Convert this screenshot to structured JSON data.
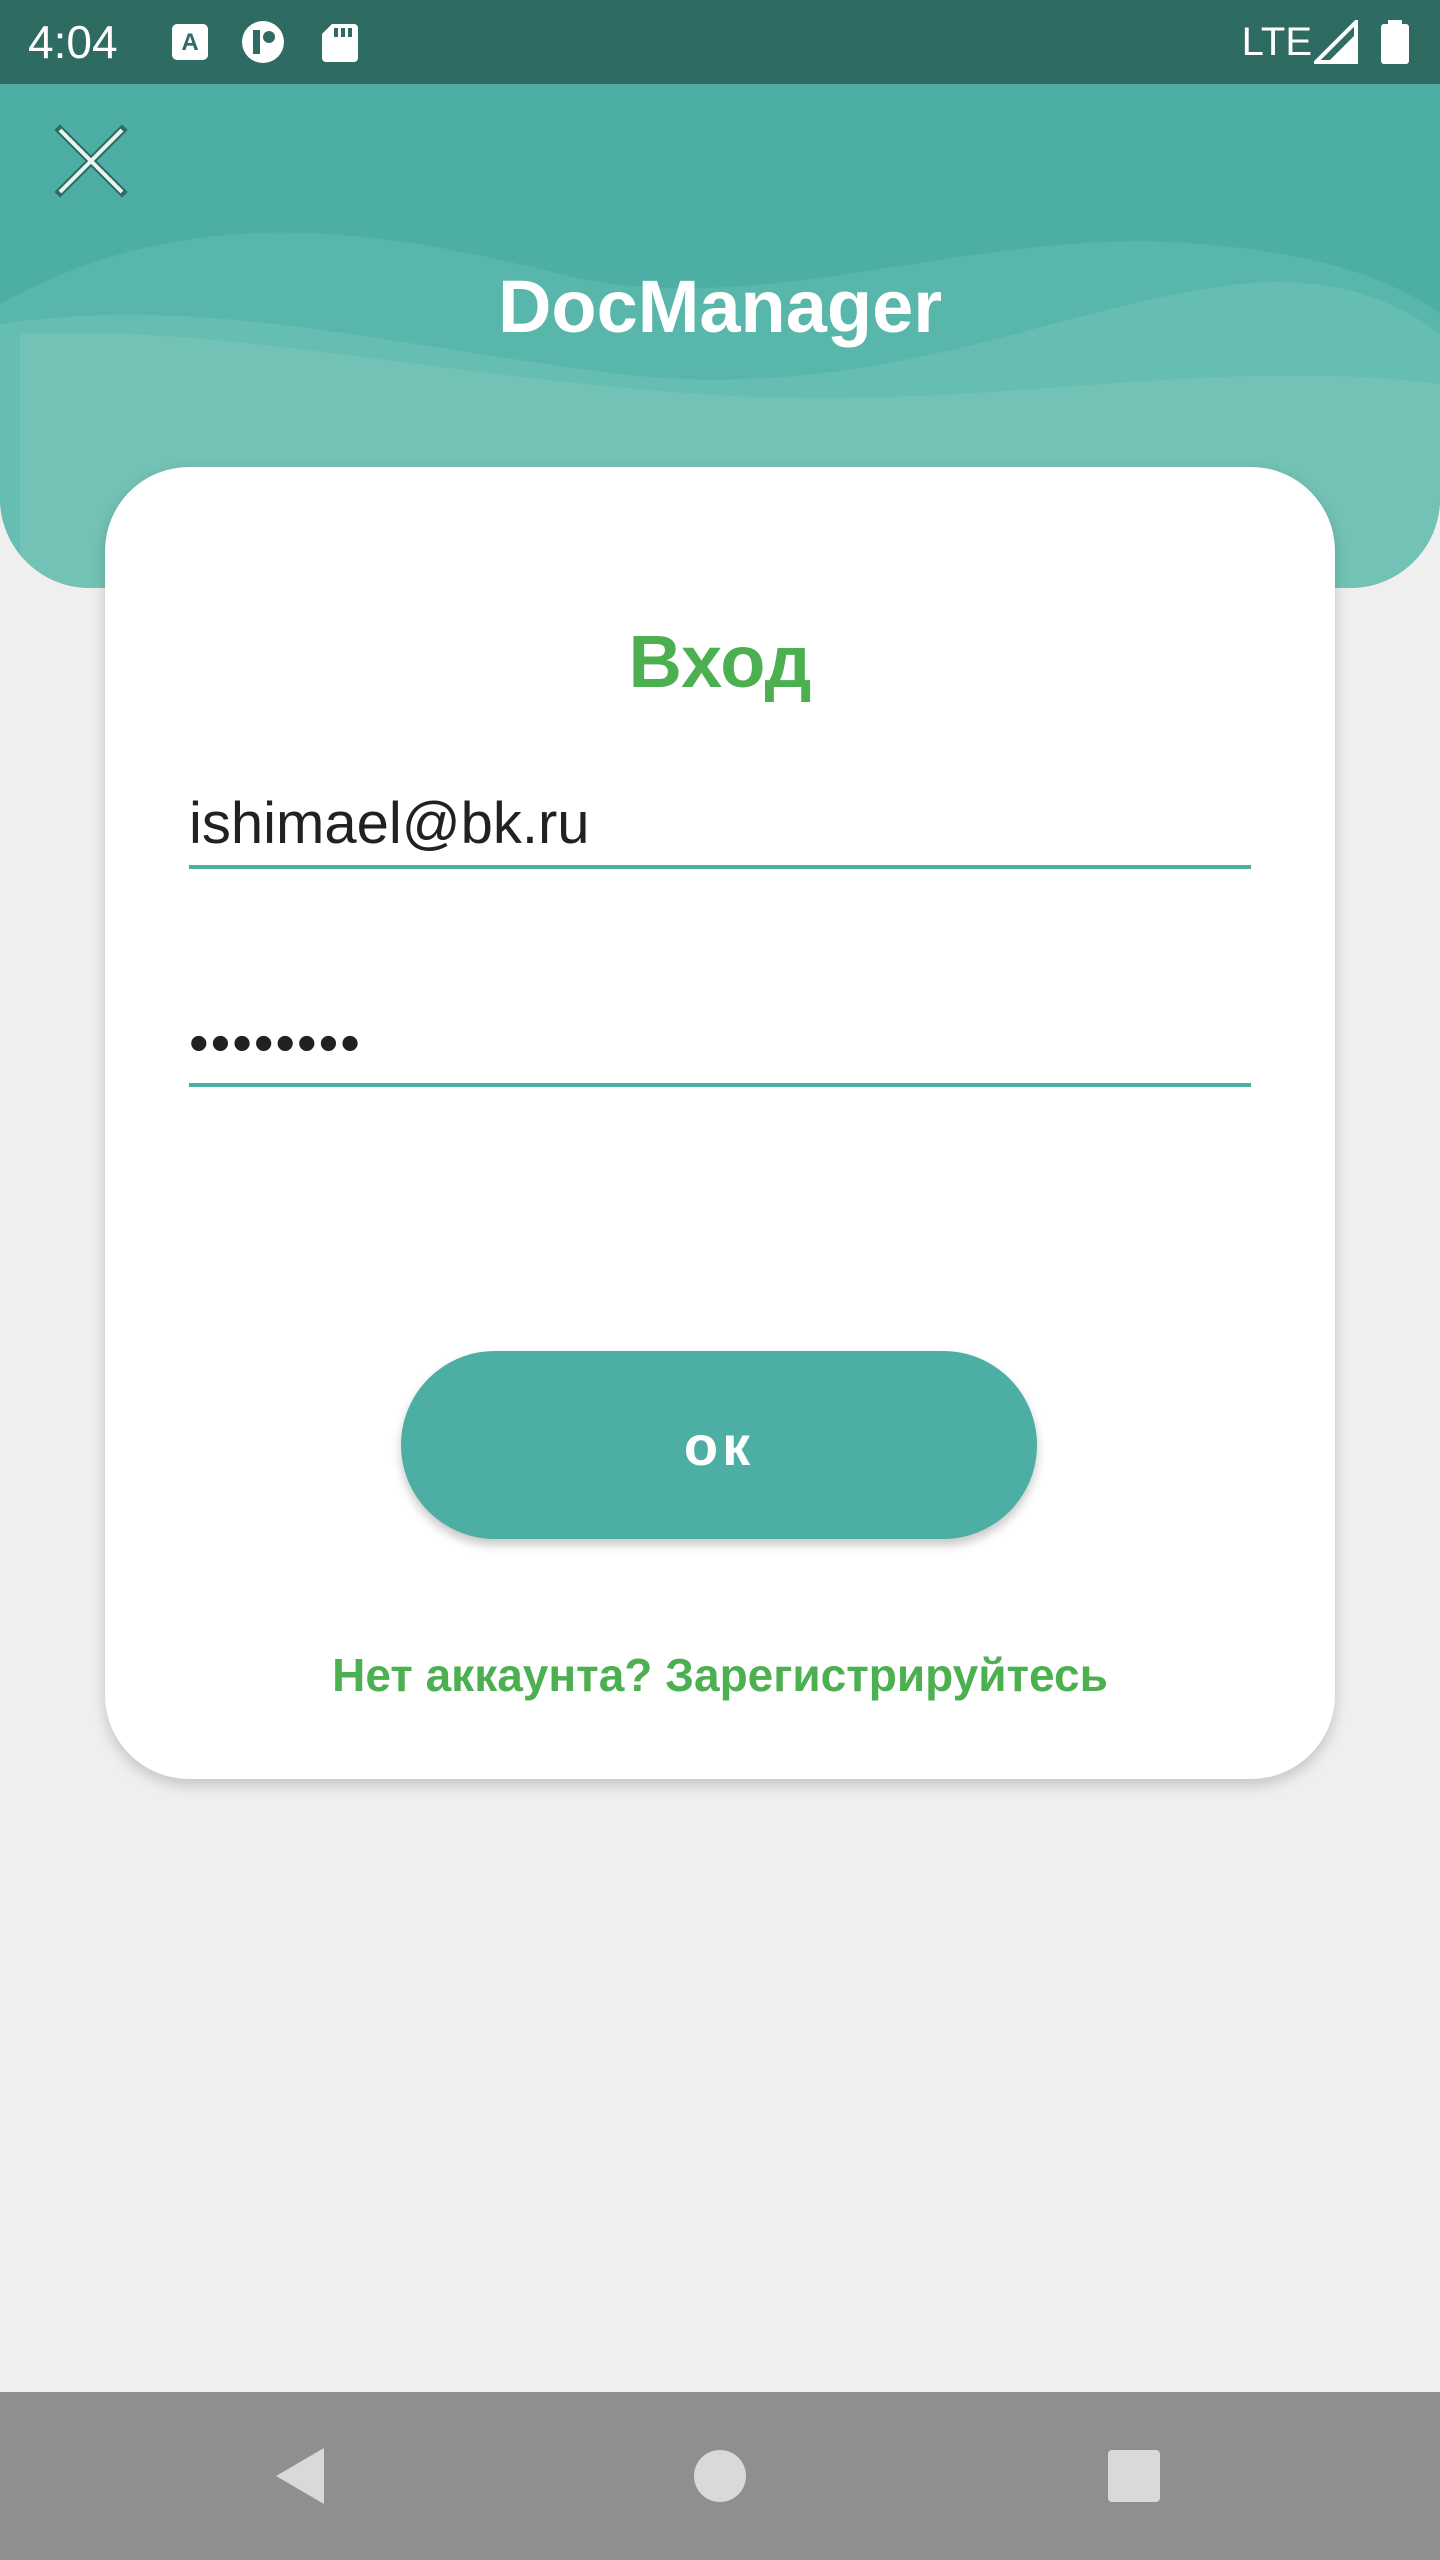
{
  "status_bar": {
    "time": "4:04",
    "network": "LTE",
    "icons": [
      "keyboard-a-icon",
      "cloud-app-icon",
      "sd-card-icon",
      "signal-icon",
      "battery-icon"
    ]
  },
  "header": {
    "app_title": "DocManager",
    "close_icon": "close-icon"
  },
  "login": {
    "title": "Вход",
    "email_value": "ishimael@bk.ru",
    "password_value": "••••••••",
    "ok_label": "ок",
    "register_link": "Нет аккаунта? Зарегистрируйтесь"
  },
  "nav": {
    "icons": [
      "back-icon",
      "home-icon",
      "recents-icon"
    ]
  },
  "colors": {
    "accent": "#4dafa3",
    "status_bar": "#2e6b62",
    "title_green": "#4caf50",
    "background": "#efefef",
    "nav_bar": "#8f8f8f"
  }
}
